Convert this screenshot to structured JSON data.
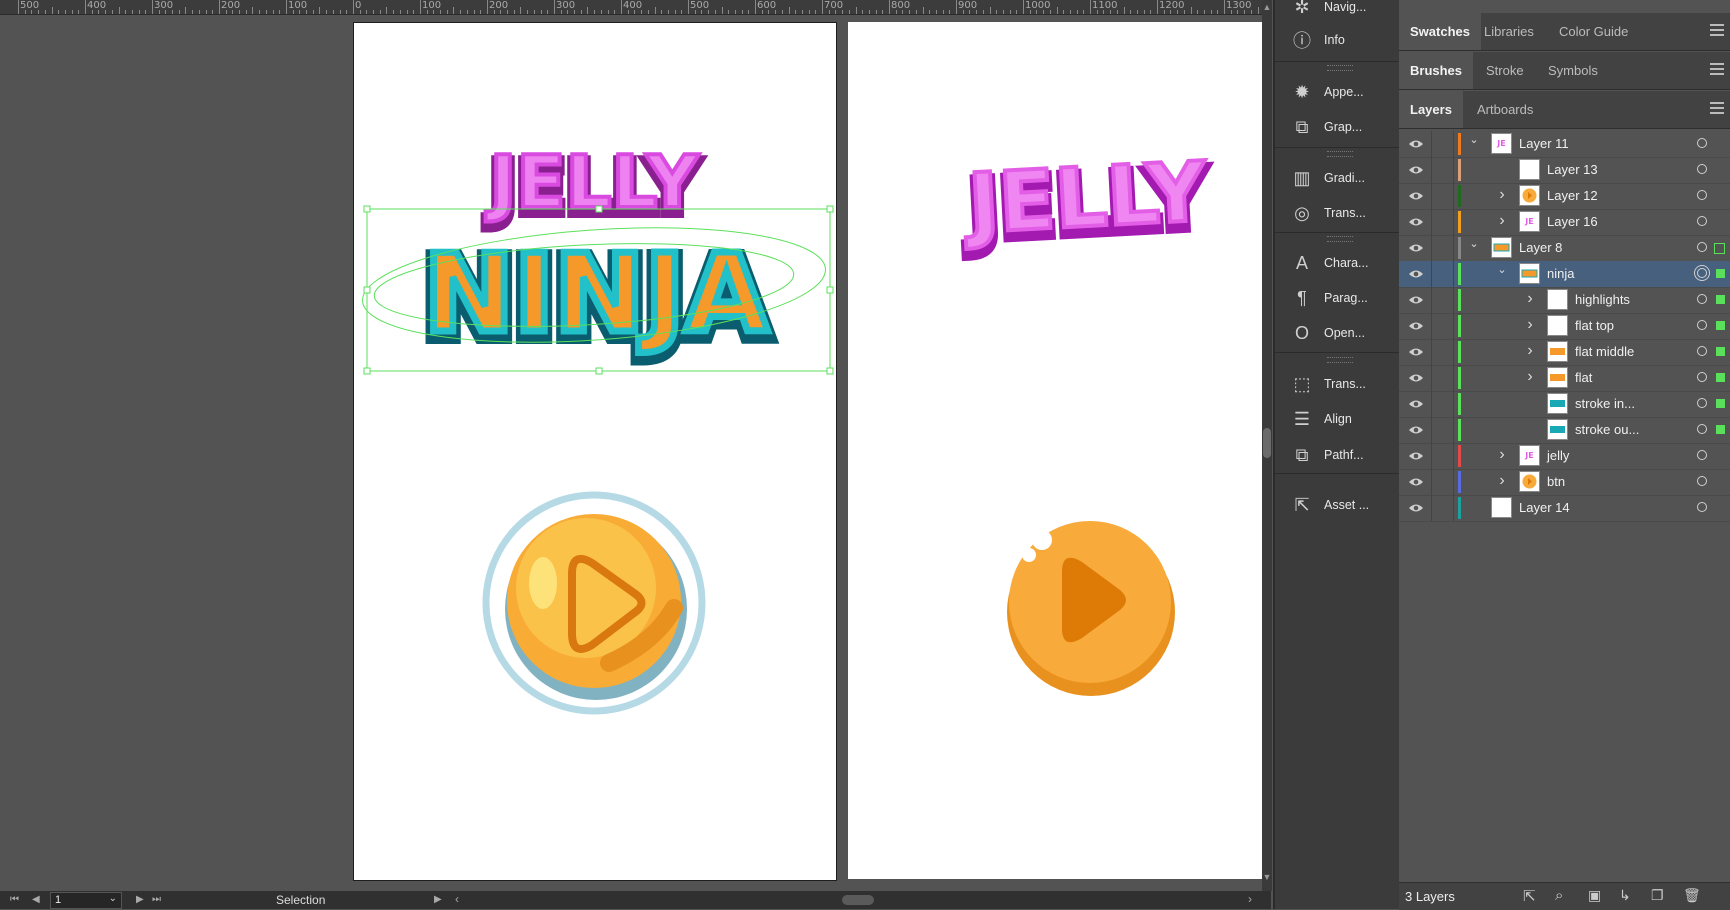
{
  "ruler": {
    "labels": [
      "500",
      "400",
      "300",
      "200",
      "100",
      "0",
      "100",
      "200",
      "300",
      "400",
      "500",
      "600",
      "700",
      "800",
      "900",
      "1000",
      "1100",
      "1200",
      "1300"
    ]
  },
  "canvas": {
    "logo_top_text": "JELLY",
    "logo_bottom_text": "NINJA",
    "right_logo_text": "JELLY"
  },
  "dock": {
    "items": [
      {
        "label": "Navig...",
        "icon": "navigator-icon"
      },
      {
        "label": "Info",
        "icon": "info-icon"
      },
      {
        "label": "Appe...",
        "icon": "appearance-icon"
      },
      {
        "label": "Grap...",
        "icon": "graphic-styles-icon"
      },
      {
        "label": "Gradi...",
        "icon": "gradient-icon"
      },
      {
        "label": "Trans...",
        "icon": "transparency-icon"
      },
      {
        "label": "Chara...",
        "icon": "character-icon"
      },
      {
        "label": "Parag...",
        "icon": "paragraph-icon"
      },
      {
        "label": "Open...",
        "icon": "opentype-icon"
      },
      {
        "label": "Trans...",
        "icon": "transform-icon"
      },
      {
        "label": "Align",
        "icon": "align-icon"
      },
      {
        "label": "Pathf...",
        "icon": "pathfinder-icon"
      },
      {
        "label": "Asset ...",
        "icon": "asset-export-icon"
      }
    ]
  },
  "panel": {
    "tabs_row1": [
      "Swatches",
      "Libraries",
      "Color Guide"
    ],
    "tabs_row2": [
      "Brushes",
      "Stroke",
      "Symbols"
    ],
    "tabs_row3": [
      "Layers",
      "Artboards"
    ],
    "layers": [
      {
        "name": "Layer 11",
        "color": "#f07a1e",
        "indent": 0,
        "chevron": "down",
        "thumb": "jelly"
      },
      {
        "name": "Layer 13",
        "color": "#d9a07a",
        "indent": 1,
        "chevron": "",
        "thumb": "blank"
      },
      {
        "name": "Layer 12",
        "color": "#1e6b1e",
        "indent": 1,
        "chevron": "right",
        "thumb": "btn"
      },
      {
        "name": "Layer 16",
        "color": "#f0a01e",
        "indent": 1,
        "chevron": "right",
        "thumb": "jelly"
      },
      {
        "name": "Layer 8",
        "color": "#888888",
        "indent": 0,
        "chevron": "down",
        "thumb": "logo"
      },
      {
        "name": "ninja",
        "color": "#5be05b",
        "indent": 1,
        "chevron": "down",
        "thumb": "logo",
        "selected": true
      },
      {
        "name": "highlights",
        "color": "#5be05b",
        "indent": 2,
        "chevron": "right",
        "thumb": "blank"
      },
      {
        "name": "flat top",
        "color": "#5be05b",
        "indent": 2,
        "chevron": "right",
        "thumb": "blank"
      },
      {
        "name": "flat middle",
        "color": "#5be05b",
        "indent": 2,
        "chevron": "right",
        "thumb": "ninja"
      },
      {
        "name": "flat",
        "color": "#5be05b",
        "indent": 2,
        "chevron": "right",
        "thumb": "ninja"
      },
      {
        "name": "stroke in...",
        "color": "#5be05b",
        "indent": 2,
        "chevron": "",
        "thumb": "stroke"
      },
      {
        "name": "stroke ou...",
        "color": "#5be05b",
        "indent": 2,
        "chevron": "",
        "thumb": "stroke"
      },
      {
        "name": "jelly",
        "color": "#e04a4a",
        "indent": 1,
        "chevron": "right",
        "thumb": "jelly"
      },
      {
        "name": "btn",
        "color": "#5a6ae0",
        "indent": 1,
        "chevron": "right",
        "thumb": "btn"
      },
      {
        "name": "Layer 14",
        "color": "#1ea0a0",
        "indent": 0,
        "chevron": "",
        "thumb": "blank"
      }
    ],
    "footer_count": "3 Layers"
  },
  "status": {
    "page_number": "1",
    "tool_name": "Selection"
  },
  "colors": {
    "selection": "#46607e",
    "accent_green": "#5be05b",
    "jelly_pink": "#e35ee6",
    "ninja_orange": "#f59a2a",
    "ninja_teal": "#19a9b5",
    "button_orange": "#f8aa3a"
  }
}
